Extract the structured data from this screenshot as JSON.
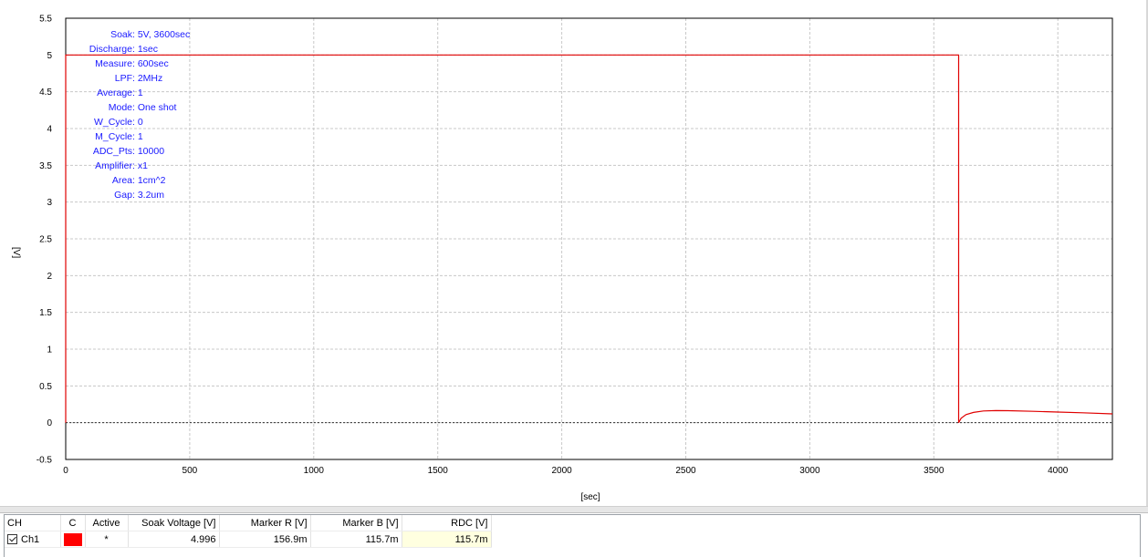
{
  "chart_data": {
    "type": "line",
    "xlabel": "[sec]",
    "ylabel": "[V]",
    "xlim": [
      0,
      4220
    ],
    "ylim": [
      -0.5,
      5.5
    ],
    "x_ticks": [
      "0",
      "500",
      "1000",
      "1500",
      "2000",
      "2500",
      "3000",
      "3500",
      "4000"
    ],
    "y_ticks": [
      "-0.5",
      "0",
      "0.5",
      "1",
      "1.5",
      "2",
      "2.5",
      "3",
      "3.5",
      "4",
      "4.5",
      "5",
      "5.5"
    ],
    "grid": true,
    "zero_line": true,
    "series": [
      {
        "color": "#e00000",
        "points": [
          [
            0,
            0
          ],
          [
            0,
            5
          ],
          [
            3600,
            5
          ],
          [
            3600,
            0
          ],
          [
            3610,
            0.06
          ],
          [
            3630,
            0.11
          ],
          [
            3660,
            0.14
          ],
          [
            3700,
            0.16
          ],
          [
            3750,
            0.165
          ],
          [
            3800,
            0.163
          ],
          [
            3900,
            0.155
          ],
          [
            4000,
            0.145
          ],
          [
            4100,
            0.135
          ],
          [
            4220,
            0.12
          ]
        ]
      }
    ],
    "annotations": [
      {
        "key": "Soak",
        "value": "5V, 3600sec"
      },
      {
        "key": "Discharge",
        "value": "1sec"
      },
      {
        "key": "Measure",
        "value": "600sec"
      },
      {
        "key": "LPF",
        "value": "2MHz"
      },
      {
        "key": "Average",
        "value": "1"
      },
      {
        "key": "Mode",
        "value": "One shot"
      },
      {
        "key": "W_Cycle",
        "value": "0"
      },
      {
        "key": "M_Cycle",
        "value": "1"
      },
      {
        "key": "ADC_Pts",
        "value": "10000"
      },
      {
        "key": "Amplifier",
        "value": "x1"
      },
      {
        "key": "Area",
        "value": "1cm^2"
      },
      {
        "key": "Gap",
        "value": "3.2um"
      }
    ]
  },
  "table": {
    "headers": {
      "ch": "CH",
      "c": "C",
      "active": "Active",
      "soak": "Soak Voltage [V]",
      "marker_r": "Marker R [V]",
      "marker_b": "Marker B [V]",
      "rdc": "RDC [V]"
    },
    "rows": [
      {
        "name": "Ch1",
        "checked": true,
        "color": "#ff0000",
        "active": "*",
        "soak": "4.996",
        "marker_r": "156.9m",
        "marker_b": "115.7m",
        "rdc": "115.7m"
      }
    ]
  }
}
